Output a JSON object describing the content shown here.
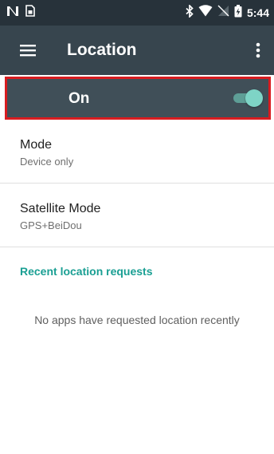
{
  "status_bar": {
    "time": "5:44",
    "left_icons": [
      "nfc-icon",
      "sim-notification-icon"
    ],
    "right_icons": [
      "bluetooth-icon",
      "wifi-icon",
      "no-signal-icon",
      "battery-icon"
    ]
  },
  "toolbar": {
    "title": "Location",
    "menu_icon": "hamburger-menu-icon",
    "overflow_icon": "more-vert-icon"
  },
  "master_switch": {
    "label": "On",
    "checked": true,
    "highlight_color": "#d81c20"
  },
  "preferences": [
    {
      "title": "Mode",
      "summary": "Device only"
    },
    {
      "title": "Satellite Mode",
      "summary": "GPS+BeiDou"
    }
  ],
  "recent_requests": {
    "header": "Recent location requests",
    "empty_text": "No apps have requested location recently"
  },
  "colors": {
    "status_bar_bg": "#27323a",
    "toolbar_bg": "#37454e",
    "switch_bar_bg": "#404f58",
    "accent": "#1a9f93",
    "toggle_thumb": "#7ed4c6"
  }
}
